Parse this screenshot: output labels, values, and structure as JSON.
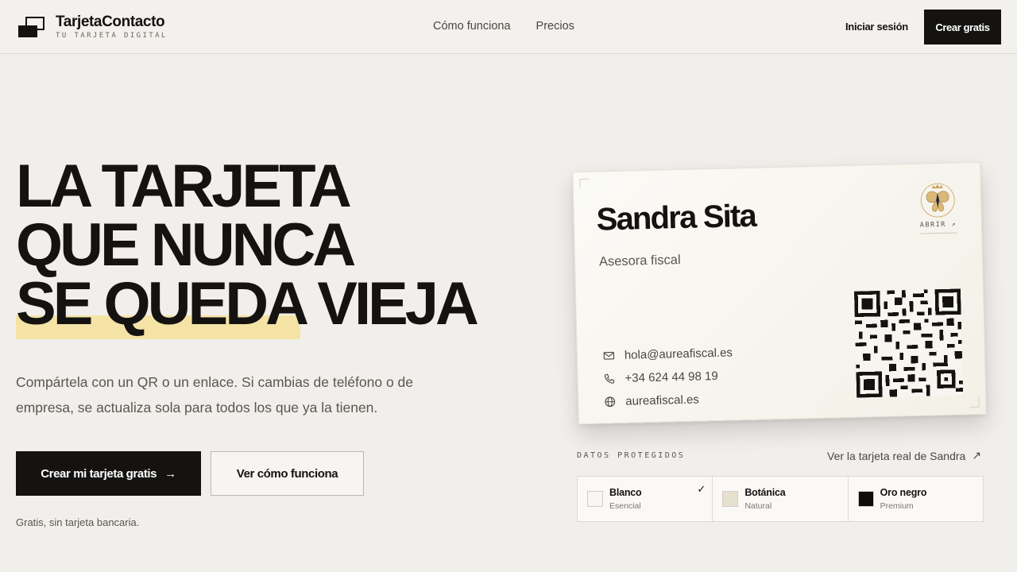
{
  "header": {
    "brand_name": "TarjetaContacto",
    "brand_tagline": "TU TARJETA DIGITAL",
    "nav": [
      "Cómo funciona",
      "Precios"
    ],
    "login_label": "Iniciar sesión",
    "signup_label": "Crear gratis"
  },
  "hero": {
    "headline_lines": [
      "LA TARJETA",
      "QUE NUNCA",
      "SE QUEDA VIEJA"
    ],
    "subtitle": "Compártela con un QR o un enlace. Si cambias de teléfono o de empresa, se actualiza sola para todos los que ya la tienen.",
    "primary_cta": "Crear mi tarjeta gratis",
    "primary_cta_arrow": "→",
    "secondary_cta": "Ver cómo funciona",
    "note": "Gratis, sin tarjeta bancaria."
  },
  "card": {
    "name": "Sandra Sita",
    "role": "Asesora fiscal",
    "open_label": "ABRIR ↗",
    "contacts": [
      {
        "icon": "mail-icon",
        "value": "hola@aureafiscal.es"
      },
      {
        "icon": "phone-icon",
        "value": "+34 624 44 98 19"
      },
      {
        "icon": "globe-icon",
        "value": "aureafiscal.es"
      }
    ]
  },
  "below_card": {
    "datos_label": "DATOS PROTEGIDOS",
    "real_card_link": "Ver la tarjeta real de Sandra",
    "real_card_arrow": "↗"
  },
  "themes": [
    {
      "name": "Blanco",
      "tier": "Esencial",
      "swatch": "#f7f6f2",
      "selected": true
    },
    {
      "name": "Botánica",
      "tier": "Natural",
      "swatch": "#e6e1cf",
      "selected": false
    },
    {
      "name": "Oro negro",
      "tier": "Premium",
      "swatch": "#0e0d0b",
      "selected": false
    }
  ],
  "colors": {
    "ink": "#141311",
    "background": "#f1efeb",
    "highlight": "#f5e3a6",
    "gold": "#c9a25a"
  }
}
